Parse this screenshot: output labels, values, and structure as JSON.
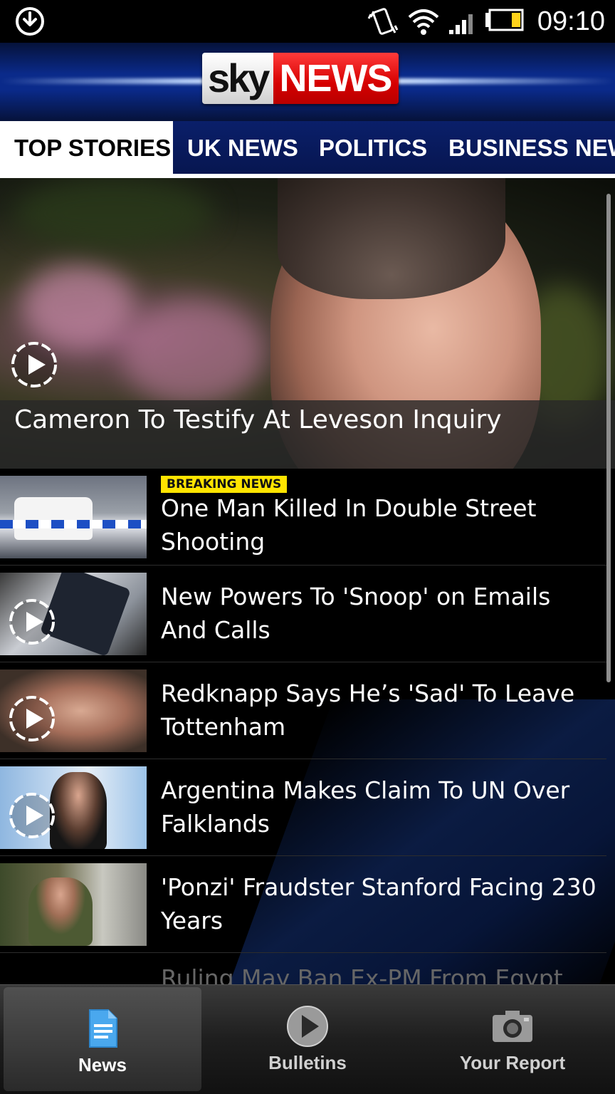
{
  "status_bar": {
    "time": "09:10",
    "icons": [
      "download-icon",
      "vibrate-icon",
      "wifi-icon",
      "signal-icon",
      "battery-icon"
    ]
  },
  "header": {
    "logo_sky": "sky",
    "logo_news": "NEWS"
  },
  "tabs": [
    {
      "label": "TOP STORIES",
      "active": true
    },
    {
      "label": "UK NEWS",
      "active": false
    },
    {
      "label": "POLITICS",
      "active": false
    },
    {
      "label": "BUSINESS NEWS",
      "active": false
    }
  ],
  "hero": {
    "headline": "Cameron To Testify At Leveson Inquiry",
    "has_video": true
  },
  "stories": [
    {
      "badge": "BREAKING NEWS",
      "title": "One Man Killed In Double Street Shooting",
      "has_video": false
    },
    {
      "badge": "",
      "title": "New Powers To 'Snoop' on Emails And Calls",
      "has_video": true
    },
    {
      "badge": "",
      "title": "Redknapp Says He’s 'Sad' To Leave Tottenham",
      "has_video": true
    },
    {
      "badge": "",
      "title": "Argentina Makes Claim To UN Over Falklands",
      "has_video": true
    },
    {
      "badge": "",
      "title": "'Ponzi' Fraudster Stanford Facing 230 Years",
      "has_video": false
    }
  ],
  "partial_story": "Ruling May Ban Ex-PM From Egypt",
  "bottom_nav": [
    {
      "label": "News",
      "icon": "document-icon",
      "active": true
    },
    {
      "label": "Bulletins",
      "icon": "play-icon",
      "active": false
    },
    {
      "label": "Your Report",
      "icon": "camera-icon",
      "active": false
    }
  ],
  "colors": {
    "header_blue": "#0a2a8a",
    "brand_red": "#d60000",
    "badge_yellow": "#ffe400"
  }
}
